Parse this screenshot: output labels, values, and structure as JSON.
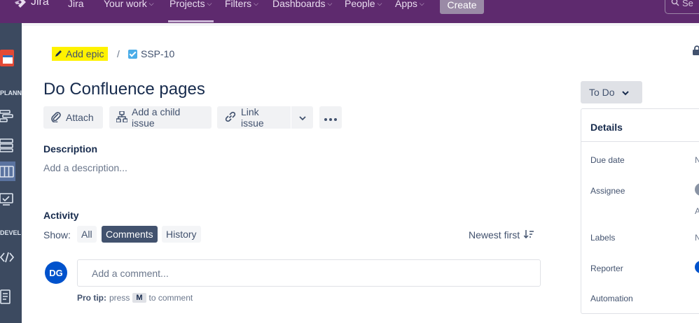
{
  "topnav": {
    "logo_text": "Jira",
    "items": [
      "Jira",
      "Your work",
      "Projects",
      "Filters",
      "Dashboards",
      "People",
      "Apps"
    ],
    "create_label": "Create",
    "search_placeholder": "Se"
  },
  "sidebar": {
    "labels": [
      "PLANN",
      "DEVEL"
    ]
  },
  "issue": {
    "add_epic_label": "Add epic",
    "breadcrumb_sep": "/",
    "key": "SSP-10",
    "title": "Do Confluence pages",
    "actions": {
      "attach": "Attach",
      "add_child": "Add a child issue",
      "link_issue": "Link issue"
    },
    "description": {
      "heading": "Description",
      "placeholder": "Add a description..."
    },
    "activity": {
      "heading": "Activity",
      "show_label": "Show:",
      "filters": [
        "All",
        "Comments",
        "History"
      ],
      "active_filter": "Comments",
      "sort_label": "Newest first",
      "avatar_initials": "DG",
      "comment_placeholder": "Add a comment...",
      "protip_bold": "Pro tip:",
      "protip_press": "press",
      "protip_key": "M",
      "protip_rest": "to comment"
    },
    "status": "To Do",
    "details": {
      "heading": "Details",
      "fields": [
        {
          "label": "Due date",
          "value": "N"
        },
        {
          "label": "Assignee",
          "value": "A"
        },
        {
          "label": "Labels",
          "value": "N"
        },
        {
          "label": "Reporter",
          "value": ""
        },
        {
          "label": "Automation",
          "value": ""
        }
      ]
    }
  },
  "colors": {
    "nav_bg": "#5e2a6e",
    "highlight": "#fff200",
    "primary_blue": "#0052cc",
    "active_filter_bg": "#42526e"
  }
}
